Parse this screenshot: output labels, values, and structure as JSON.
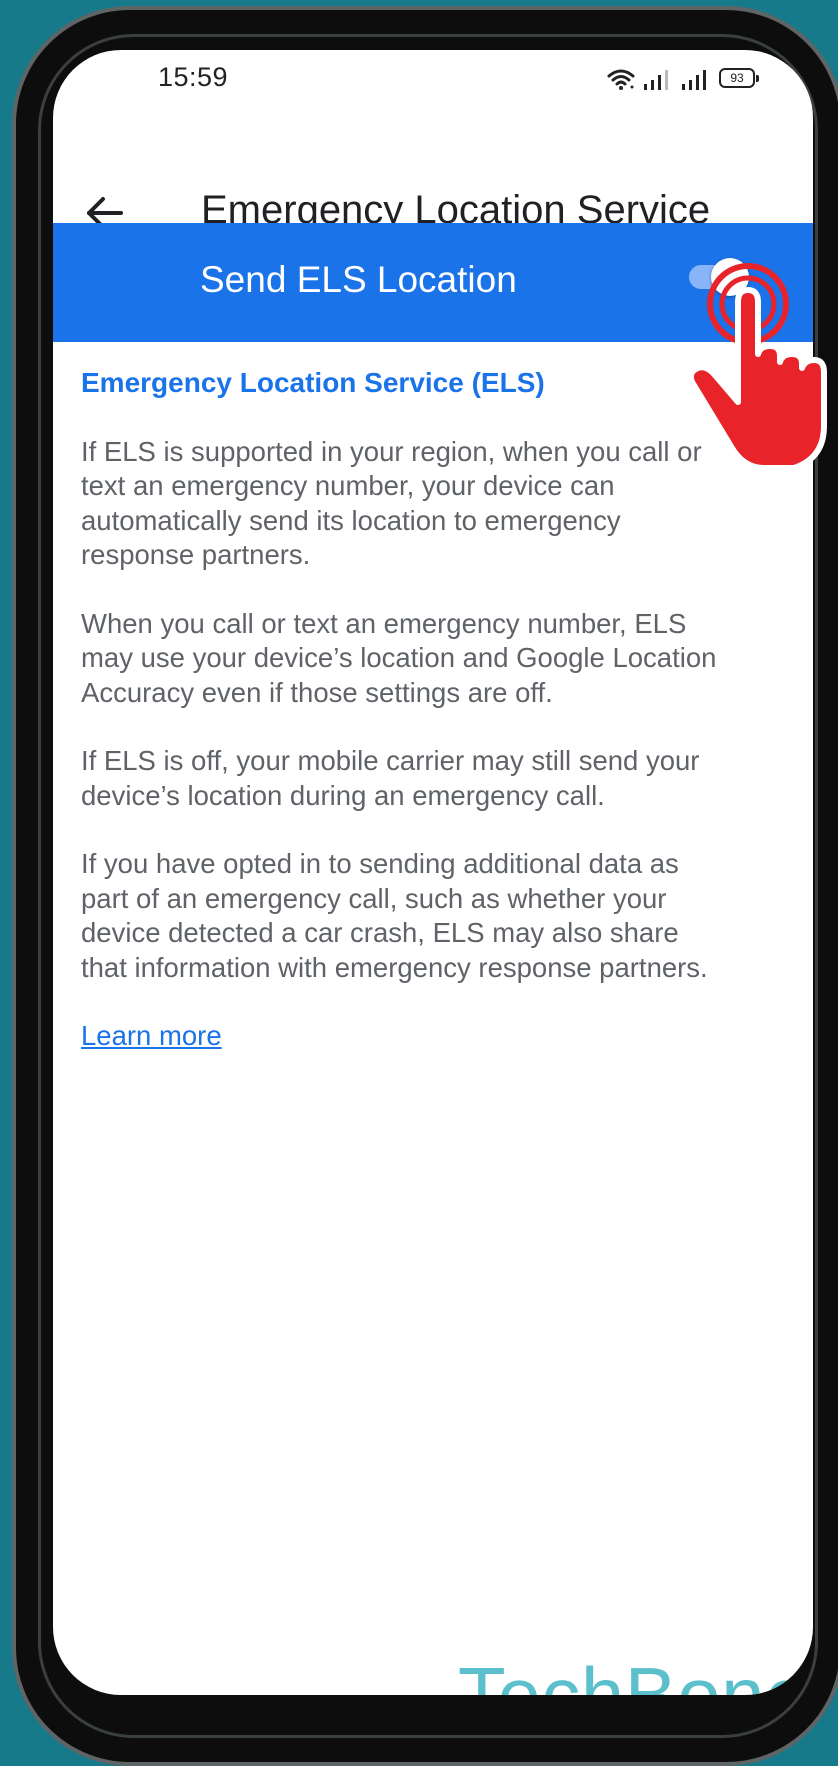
{
  "status_bar": {
    "time": "15:59",
    "battery": "93",
    "icons": [
      "wifi-icon",
      "signal-icon",
      "signal-icon",
      "battery-icon"
    ]
  },
  "header": {
    "back_icon": "arrow-left-icon",
    "title": "Emergency Location Service"
  },
  "banner": {
    "label": "Send ELS Location",
    "toggle_on": true,
    "background": "#1a73e8"
  },
  "content": {
    "heading": "Emergency Location Service (ELS)",
    "paragraphs": [
      "If ELS is supported in your region, when you call or text an emergency number, your device can automatically send its location to emergency response partners.",
      "When you call or text an emergency number, ELS may use your device’s location and Google Location Accuracy even if those settings are off.",
      "If ELS is off, your mobile carrier may still send your device’s location during an emergency call.",
      "If you have opted in to sending additional data as part of an emergency call, such as whether your device detected a car crash, ELS may also share that information with emergency response partners."
    ],
    "link": "Learn more"
  },
  "watermark": "TechBone",
  "colors": {
    "accent": "#1a73e8",
    "background": "#167a8a",
    "watermark": "#5bc0cc",
    "pointer": "#e8232a"
  }
}
